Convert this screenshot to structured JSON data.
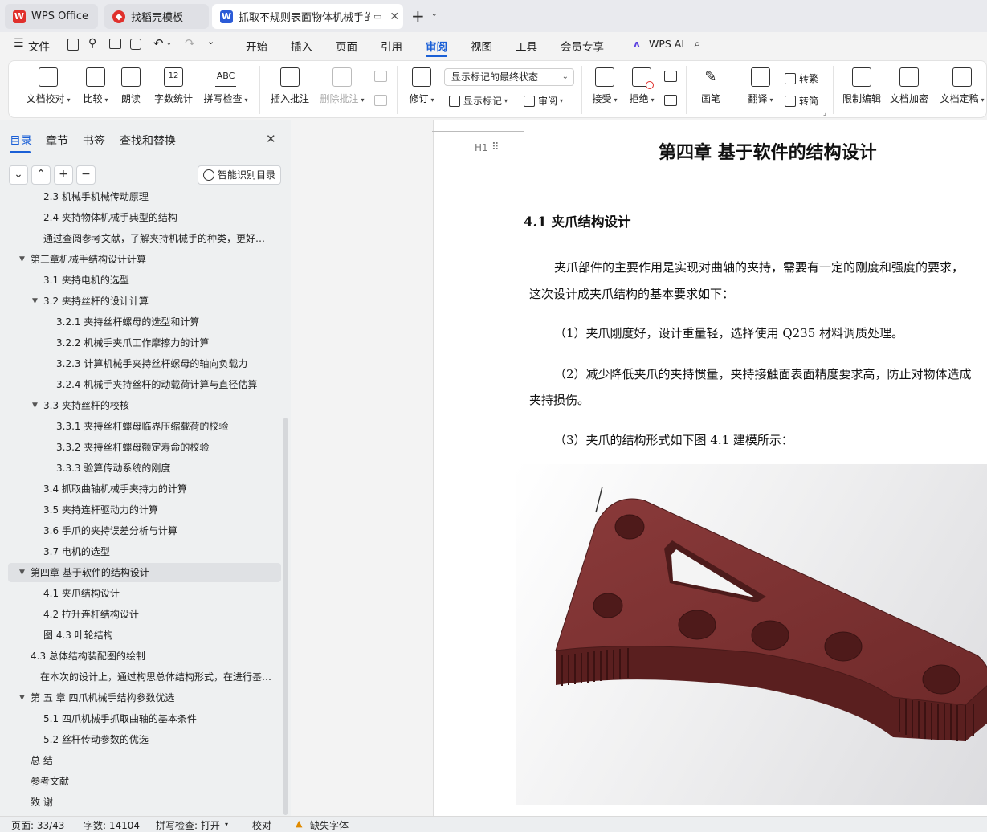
{
  "tabs": [
    {
      "label": "WPS Office",
      "icon": "wps-logo-icon"
    },
    {
      "label": "找稻壳模板",
      "icon": "docer-icon"
    },
    {
      "label": "抓取不规则表面物体机械手的设",
      "icon": "word-doc-icon"
    }
  ],
  "menu": {
    "file_label": "文件",
    "items": [
      "开始",
      "插入",
      "页面",
      "引用",
      "审阅",
      "视图",
      "工具",
      "会员专享"
    ],
    "active": "审阅",
    "ai_label": "WPS AI"
  },
  "ribbon": {
    "doc_check": "文档校对",
    "compare": "比较",
    "read_aloud": "朗读",
    "word_count": "字数统计",
    "spell_check": "拼写检查",
    "spell_icon_text": "ABC",
    "word_count_icon_text": "12",
    "insert_comment": "插入批注",
    "delete_comment": "删除批注",
    "revise": "修订",
    "markup_mode": "显示标记的最终状态",
    "show_markup": "显示标记",
    "review": "审阅",
    "accept": "接受",
    "reject": "拒绝",
    "pen": "画笔",
    "translate": "翻译",
    "to_traditional": "转繁",
    "to_simplified": "转简",
    "restrict_edit": "限制编辑",
    "encrypt": "文档加密",
    "finalize": "文档定稿"
  },
  "sidebar": {
    "tabs": [
      "目录",
      "章节",
      "书签",
      "查找和替换"
    ],
    "active_tab": "目录",
    "smart_button": "智能识别目录",
    "toc": [
      {
        "text": "2.3 机械手机械传动原理",
        "level": 2,
        "arrow": ""
      },
      {
        "text": "2.4 夹持物体机械手典型的结构",
        "level": 2,
        "arrow": ""
      },
      {
        "text": "通过查阅参考文献，了解夹持机械手的种类，更好的对夹持机械手进行设计…",
        "level": 2,
        "arrow": ""
      },
      {
        "text": "第三章机械手结构设计计算",
        "level": 1,
        "arrow": "▼"
      },
      {
        "text": "3.1 夹持电机的选型",
        "level": 2,
        "arrow": ""
      },
      {
        "text": "3.2 夹持丝杆的设计计算",
        "level": 2,
        "arrow": "▼"
      },
      {
        "text": "3.2.1 夹持丝杆螺母的选型和计算",
        "level": 3,
        "arrow": ""
      },
      {
        "text": "3.2.2 机械手夹爪工作摩擦力的计算",
        "level": 3,
        "arrow": ""
      },
      {
        "text": "3.2.3 计算机械手夹持丝杆螺母的轴向负载力",
        "level": 3,
        "arrow": ""
      },
      {
        "text": "3.2.4 机械手夹持丝杆的动载荷计算与直径估算",
        "level": 3,
        "arrow": ""
      },
      {
        "text": "3.3  夹持丝杆的校核",
        "level": 2,
        "arrow": "▼"
      },
      {
        "text": "3.3.1 夹持丝杆螺母临界压缩载荷的校验",
        "level": 3,
        "arrow": ""
      },
      {
        "text": "3.3.2 夹持丝杆螺母额定寿命的校验",
        "level": 3,
        "arrow": ""
      },
      {
        "text": "3.3.3 验算传动系统的刚度",
        "level": 3,
        "arrow": ""
      },
      {
        "text": "3.4 抓取曲轴机械手夹持力的计算",
        "level": 2,
        "arrow": ""
      },
      {
        "text": "3.5 夹持连杆驱动力的计算",
        "level": 2,
        "arrow": ""
      },
      {
        "text": "3.6 手爪的夹持误差分析与计算",
        "level": 2,
        "arrow": ""
      },
      {
        "text": "3.7 电机的选型",
        "level": 2,
        "arrow": ""
      },
      {
        "text": "第四章  基于软件的结构设计",
        "level": 1,
        "arrow": "▼",
        "selected": true
      },
      {
        "text": "4.1  夹爪结构设计",
        "level": 2,
        "arrow": ""
      },
      {
        "text": "4.2  拉升连杆结构设计",
        "level": 2,
        "arrow": ""
      },
      {
        "text": "图 4.3 叶轮结构",
        "level": 2,
        "arrow": ""
      },
      {
        "text": "4.3 总体结构装配图的绘制",
        "level": 1,
        "arrow": ""
      },
      {
        "text": "在本次的设计上，通过构思总体结构形式，在进行基本参数设计后，对机械手…",
        "level": 15,
        "arrow": ""
      },
      {
        "text": "第 五 章  四爪机械手结构参数优选",
        "level": 1,
        "arrow": "▼"
      },
      {
        "text": "5.1 四爪机械手抓取曲轴的基本条件",
        "level": 2,
        "arrow": ""
      },
      {
        "text": "5.2 丝杆传动参数的优选",
        "level": 2,
        "arrow": ""
      },
      {
        "text": "总  结",
        "level": 1,
        "arrow": ""
      },
      {
        "text": "参考文献",
        "level": 1,
        "arrow": ""
      },
      {
        "text": "致  谢",
        "level": 1,
        "arrow": ""
      }
    ]
  },
  "document": {
    "chapter_title": "第四章  基于软件的结构设计",
    "heading_marker": "H1",
    "section_title": "4.1  夹爪结构设计",
    "paragraph1_line1": "夹爪部件的主要作用是实现对曲轴的夹持，需要有一定的刚度和强度的要求，",
    "paragraph1_line2": "这次设计成夹爪结构的基本要求如下：",
    "item1": "（1）夹爪刚度好，设计重量轻，选择使用 Q235 材料调质处理。",
    "item2_line1": "（2）减少降低夹爪的夹持惯量，夹持接触面表面精度要求高，防止对物体造成",
    "item2_line2": "夹持损伤。",
    "item3": "（3）夹爪的结构形式如下图 4.1 建模所示：",
    "figure_color": "#7a3131"
  },
  "status": {
    "page": "页面: 33/43",
    "word_count": "字数: 14104",
    "spell_check": "拼写检查: 打开",
    "proofread": "校对",
    "missing_font": "缺失字体"
  },
  "colors": {
    "accent": "#1a5fd6",
    "wps_red": "#e0302c",
    "doc_blue": "#2b5bd7"
  }
}
